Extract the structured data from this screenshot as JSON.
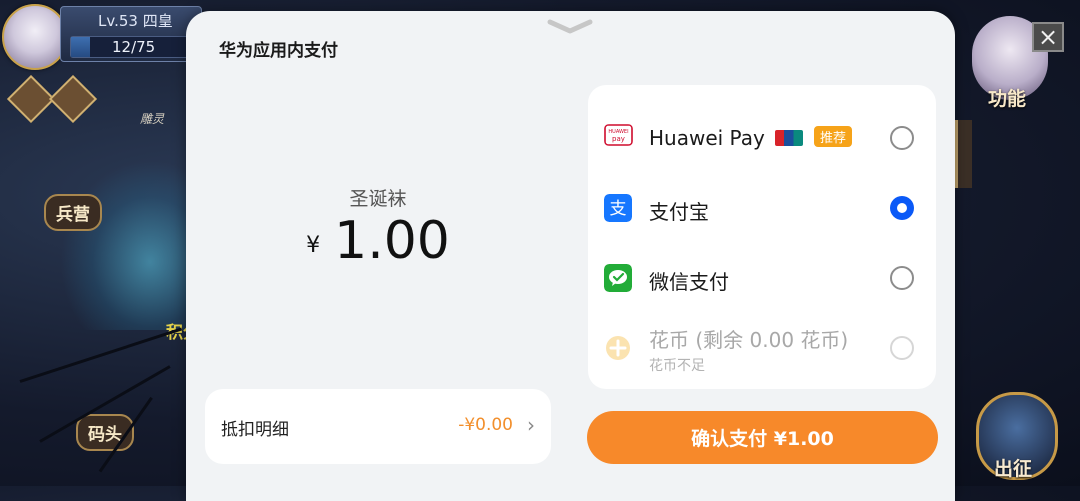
{
  "game_hud": {
    "level_text": "Lv.53 四皇",
    "exp_text": "12/75",
    "exp_progress": 0.16,
    "building_labels": {
      "barracks": "兵营",
      "dock": "码头",
      "points": "积分",
      "sign": "雕灵",
      "function": "功能",
      "sortie": "出征"
    },
    "close_icon": "×"
  },
  "payment": {
    "title": "华为应用内支付",
    "product_name": "圣诞袜",
    "currency_symbol": "¥",
    "price": "1.00",
    "deduction": {
      "label": "抵扣明细",
      "amount": "-¥0.00",
      "arrow": "›"
    },
    "methods": [
      {
        "icon": "huawei-pay-icon",
        "label": "Huawei Pay",
        "badge": "推荐",
        "selected": false,
        "enabled": true
      },
      {
        "icon": "alipay-icon",
        "label": "支付宝",
        "selected": true,
        "enabled": true
      },
      {
        "icon": "wechat-pay-icon",
        "label": "微信支付",
        "selected": false,
        "enabled": true
      },
      {
        "icon": "huabi-coin-icon",
        "label": "花币 (剩余 0.00 花币)",
        "sublabel": "花币不足",
        "selected": false,
        "enabled": false
      }
    ],
    "confirm_label": "确认支付 ¥1.00",
    "colors": {
      "accent": "#F7892A",
      "radio_selected": "#0A59F7",
      "alipay": "#1677FF",
      "wechat": "#22AC38",
      "badge": "#F6A319"
    }
  }
}
